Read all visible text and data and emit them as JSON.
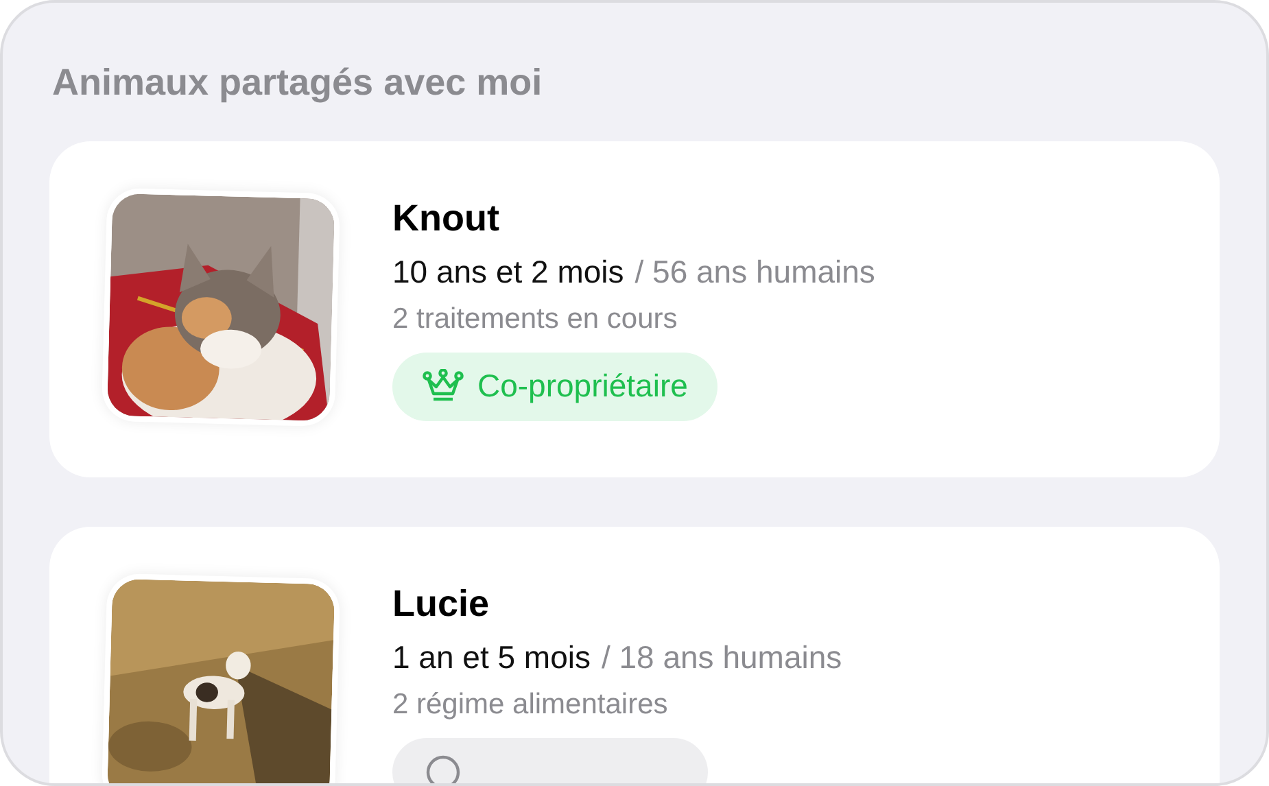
{
  "section_title": "Animaux partagés avec moi",
  "pets": [
    {
      "name": "Knout",
      "age": "10 ans et 2 mois",
      "human_age": "/ 56 ans humains",
      "info": "2 traitements en cours",
      "badge": {
        "kind": "owner",
        "label": "Co-propriétaire"
      }
    },
    {
      "name": "Lucie",
      "age": "1 an et 5 mois",
      "human_age": "/ 18 ans humains",
      "info": "2 régime alimentaires",
      "badge": {
        "kind": "neutral"
      }
    }
  ]
}
